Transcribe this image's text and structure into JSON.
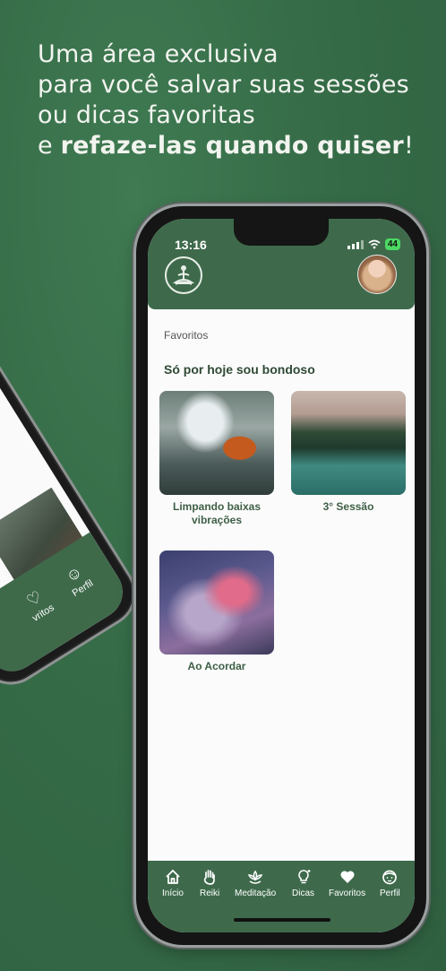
{
  "headline": {
    "line1": "Uma área exclusiva",
    "line2": "para você salvar suas sessões",
    "line3": "ou dicas favoritas",
    "line4_prefix": "e ",
    "line4_bold": "refaze-las quando quiser",
    "line4_suffix": "!"
  },
  "status_bar": {
    "time": "13:16",
    "battery": "44"
  },
  "breadcrumb": "Favoritos",
  "section_title": "Só por hoje sou bondoso",
  "cards": [
    {
      "caption": "Limpando baixas vibrações",
      "icon": "monk-water-image"
    },
    {
      "caption": "3° Sessão",
      "icon": "lake-mountain-image"
    },
    {
      "caption": "Ao Acordar",
      "icon": "hands-energy-image"
    }
  ],
  "tabs": [
    {
      "label": "Início",
      "icon": "home-icon"
    },
    {
      "label": "Reiki",
      "icon": "hand-icon"
    },
    {
      "label": "Meditação",
      "icon": "lotus-icon"
    },
    {
      "label": "Dicas",
      "icon": "lightbulb-icon"
    },
    {
      "label": "Favoritos",
      "icon": "heart-icon"
    },
    {
      "label": "Perfil",
      "icon": "profile-face-icon"
    }
  ],
  "background_phone_tabs": [
    {
      "label": "vritos",
      "icon": "heart-icon"
    },
    {
      "label": "Perfil",
      "icon": "profile-face-icon"
    }
  ],
  "colors": {
    "background": "#356b47",
    "app_green": "#3e6a4b",
    "caption": "#3e5f46"
  }
}
